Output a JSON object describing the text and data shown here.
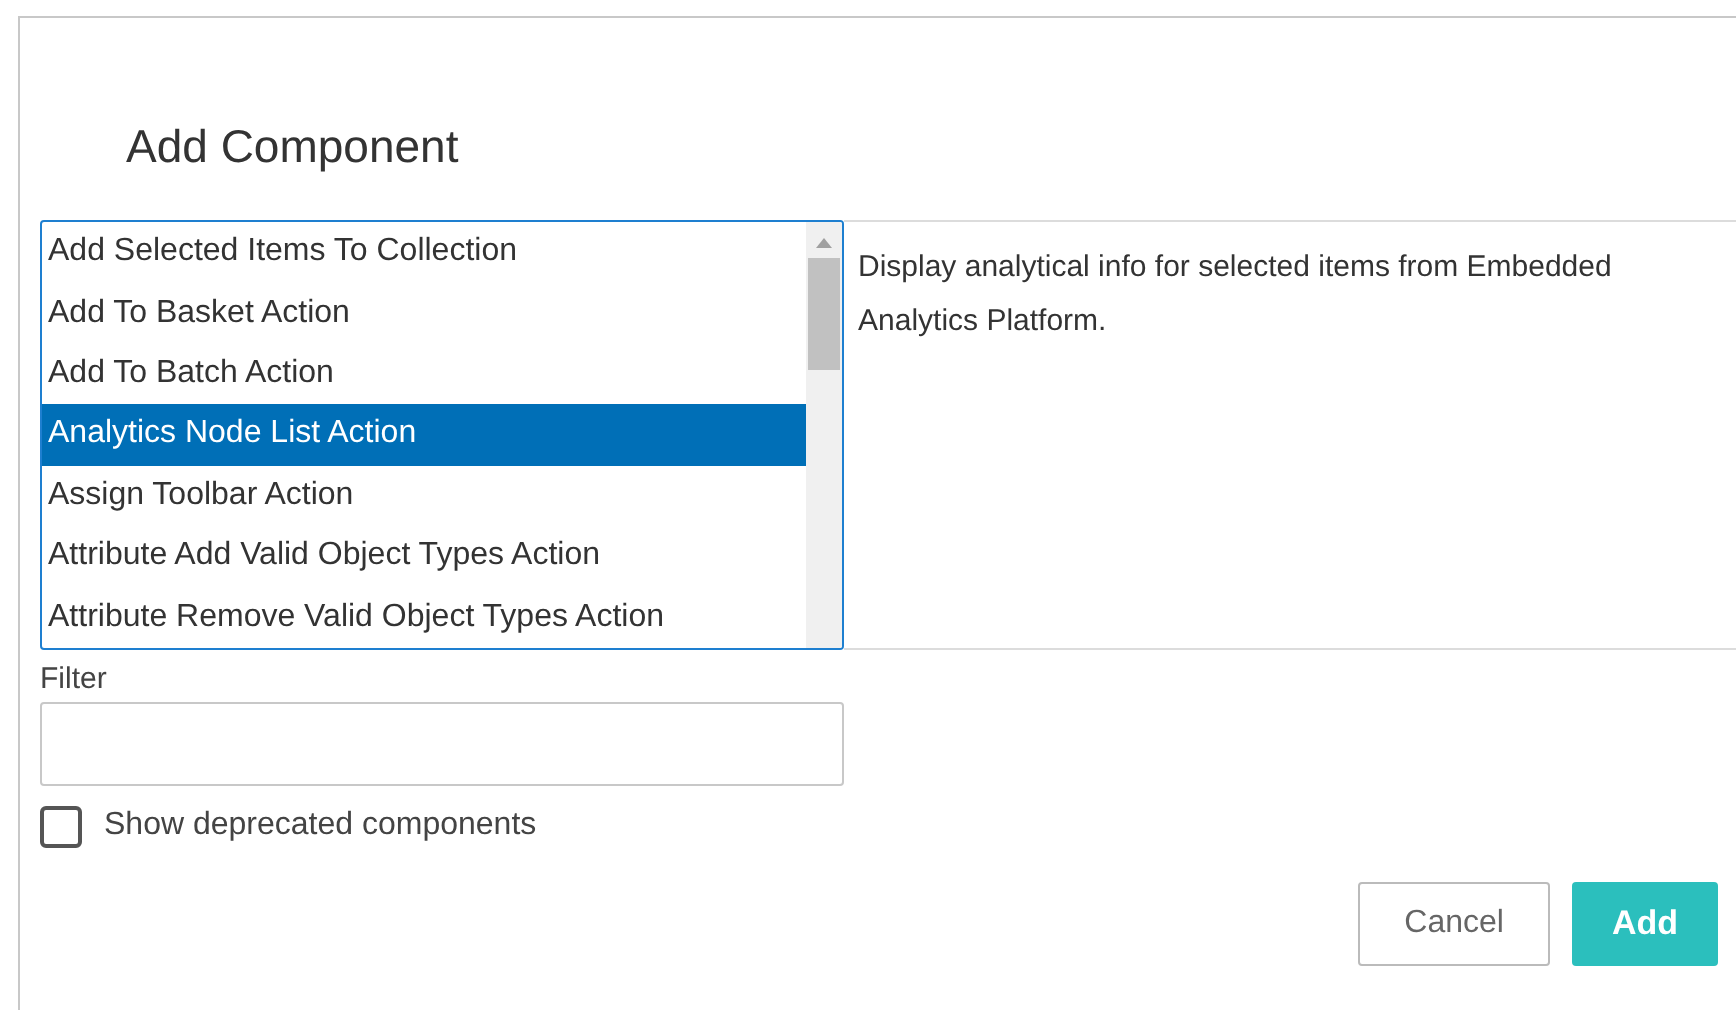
{
  "dialog": {
    "title": "Add Component"
  },
  "components": [
    {
      "label": "Add Selected Items To Collection",
      "selected": false
    },
    {
      "label": "Add To Basket Action",
      "selected": false
    },
    {
      "label": "Add To Batch Action",
      "selected": false
    },
    {
      "label": "Analytics Node List Action",
      "selected": true
    },
    {
      "label": "Assign Toolbar Action",
      "selected": false
    },
    {
      "label": "Attribute Add Valid Object Types Action",
      "selected": false
    },
    {
      "label": "Attribute Remove Valid Object Types Action",
      "selected": false
    }
  ],
  "description": "Display analytical info for selected items from Embedded Analytics Platform.",
  "filter": {
    "label": "Filter"
  },
  "show_deprecated": {
    "label": "Show deprecated components",
    "checked": false
  },
  "buttons": [
    {
      "label": "Cancel",
      "kind": "secondary"
    },
    {
      "label": "Add",
      "kind": "primary"
    }
  ]
}
